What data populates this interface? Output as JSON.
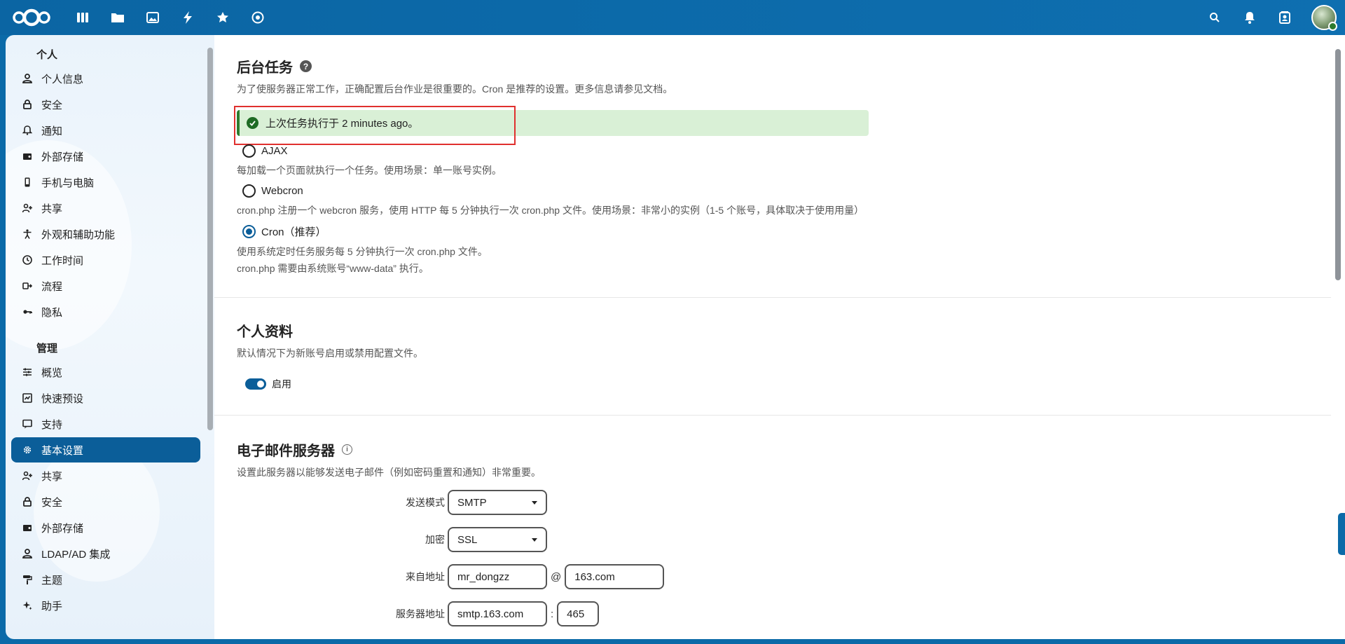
{
  "header": {
    "apps": [
      "dashboard-icon",
      "files-icon",
      "photos-icon",
      "activity-icon",
      "favorites-icon",
      "circles-icon"
    ],
    "right_icons": [
      "search-icon",
      "notifications-icon",
      "contacts-icon"
    ]
  },
  "sidebar": {
    "personal_title": "个人",
    "personal_items": [
      {
        "label": "个人信息",
        "icon": "user-icon"
      },
      {
        "label": "安全",
        "icon": "lock-icon"
      },
      {
        "label": "通知",
        "icon": "bell-icon"
      },
      {
        "label": "外部存储",
        "icon": "external-storage-icon"
      },
      {
        "label": "手机与电脑",
        "icon": "phone-icon"
      },
      {
        "label": "共享",
        "icon": "share-icon"
      },
      {
        "label": "外观和辅助功能",
        "icon": "accessibility-icon"
      },
      {
        "label": "工作时间",
        "icon": "clock-icon"
      },
      {
        "label": "流程",
        "icon": "flow-icon"
      },
      {
        "label": "隐私",
        "icon": "key-icon"
      }
    ],
    "admin_title": "管理",
    "admin_items": [
      {
        "label": "概览",
        "icon": "sliders-icon"
      },
      {
        "label": "快速预设",
        "icon": "preset-icon"
      },
      {
        "label": "支持",
        "icon": "support-icon"
      },
      {
        "label": "基本设置",
        "icon": "gear-icon",
        "active": true
      },
      {
        "label": "共享",
        "icon": "share-icon"
      },
      {
        "label": "安全",
        "icon": "lock-icon"
      },
      {
        "label": "外部存储",
        "icon": "external-storage-icon"
      },
      {
        "label": "LDAP/AD 集成",
        "icon": "user-icon"
      },
      {
        "label": "主题",
        "icon": "paint-roller-icon"
      },
      {
        "label": "助手",
        "icon": "sparkle-icon"
      }
    ]
  },
  "background_jobs": {
    "title": "后台任务",
    "description": "为了使服务器正常工作，正确配置后台作业是很重要的。Cron 是推荐的设置。更多信息请参见文档。",
    "status": "上次任务执行于 2 minutes ago。",
    "options": [
      {
        "label": "AJAX",
        "desc": "每加载一个页面就执行一个任务。使用场景：单一账号实例。",
        "checked": false
      },
      {
        "label": "Webcron",
        "desc": "cron.php 注册一个 webcron 服务，使用 HTTP 每 5 分钟执行一次 cron.php 文件。使用场景：非常小的实例（1-5 个账号，具体取决于使用用量）",
        "checked": false
      },
      {
        "label": "Cron（推荐）",
        "desc": "使用系统定时任务服务每 5 分钟执行一次 cron.php 文件。",
        "desc2": "cron.php 需要由系统账号“www-data” 执行。",
        "checked": true
      }
    ]
  },
  "profile": {
    "title": "个人资料",
    "description": "默认情况下为新账号启用或禁用配置文件。",
    "toggle_label": "启用"
  },
  "email": {
    "title": "电子邮件服务器",
    "description": "设置此服务器以能够发送电子邮件（例如密码重置和通知）非常重要。",
    "send_mode_label": "发送模式",
    "send_mode": "SMTP",
    "encryption_label": "加密",
    "encryption": "SSL",
    "from_label": "来自地址",
    "from_user": "mr_dongzz",
    "at": "@",
    "from_domain": "163.com",
    "server_label": "服务器地址",
    "server_host": "smtp.163.com",
    "colon": ":",
    "server_port": "465"
  }
}
